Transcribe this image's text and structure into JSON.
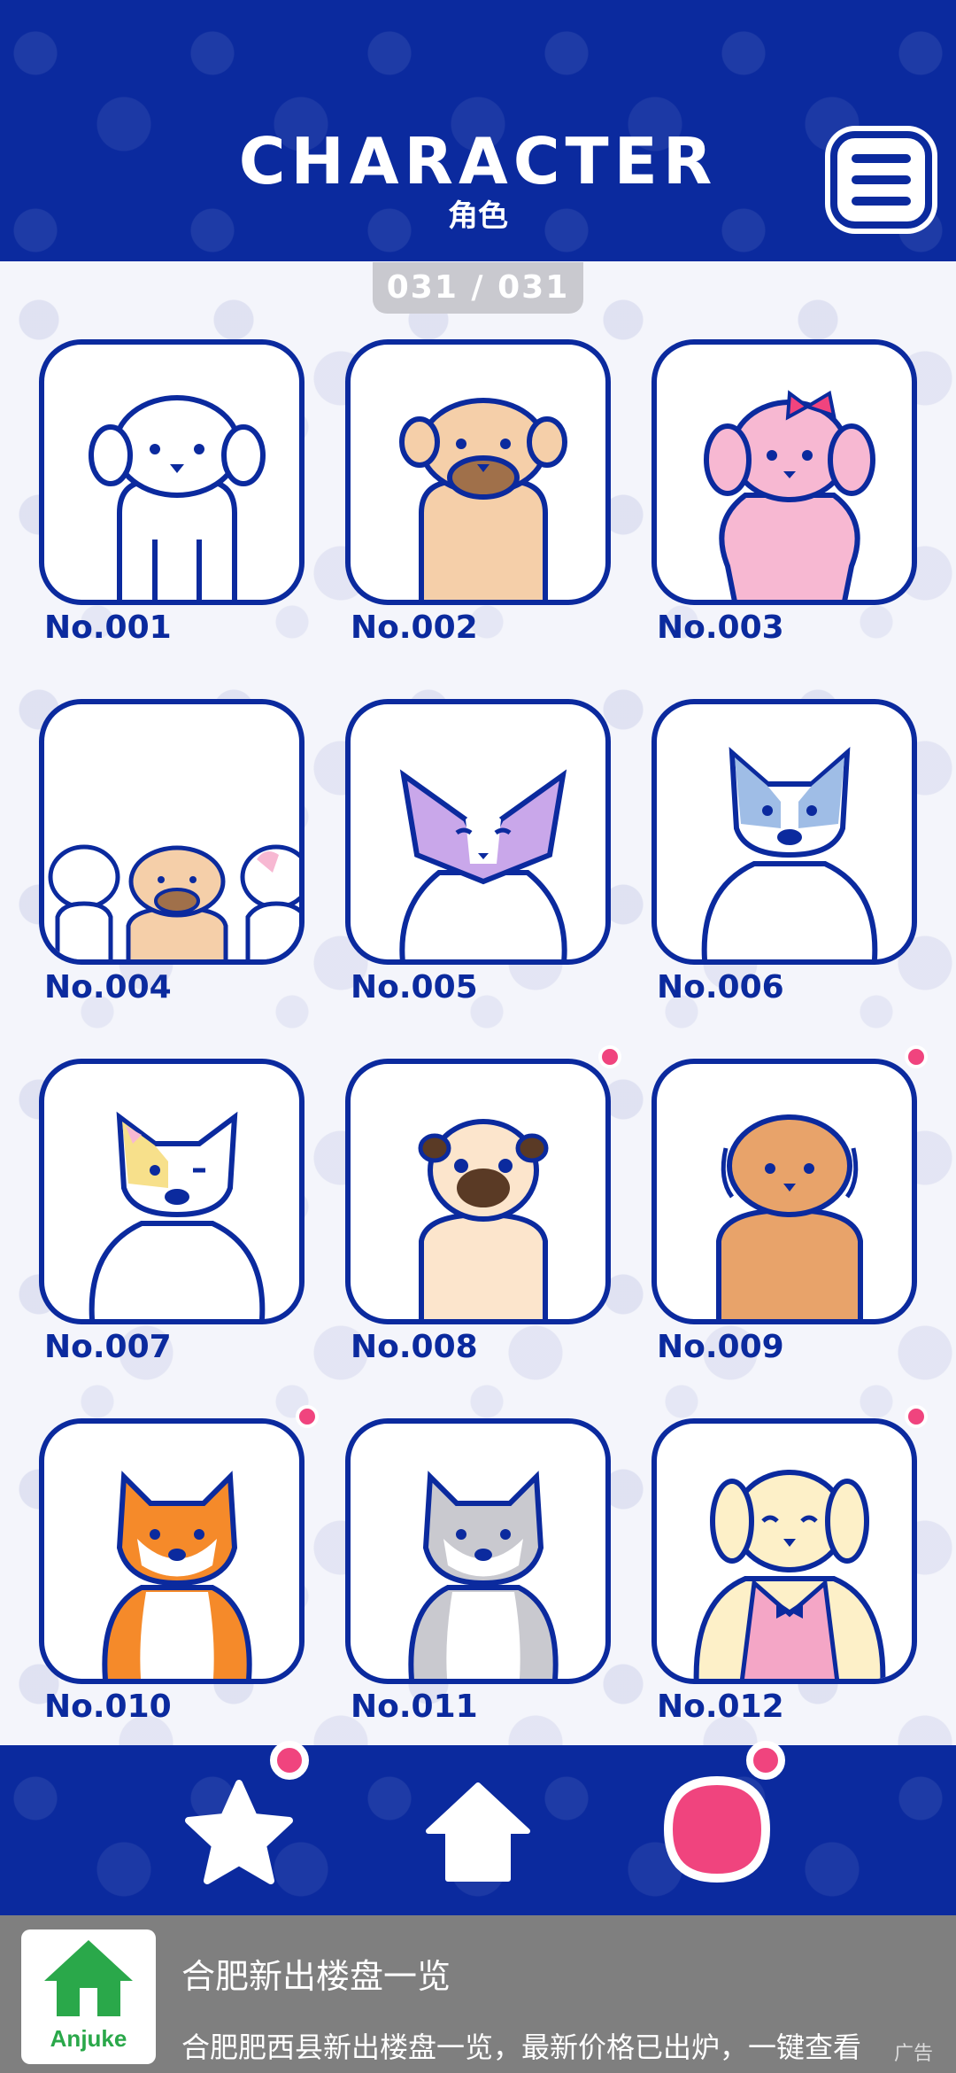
{
  "header": {
    "title": "CHARACTER",
    "subtitle": "角色"
  },
  "counter": "031 / 031",
  "characters": [
    {
      "label": "No.001",
      "new": false
    },
    {
      "label": "No.002",
      "new": false
    },
    {
      "label": "No.003",
      "new": false
    },
    {
      "label": "No.004",
      "new": false
    },
    {
      "label": "No.005",
      "new": false
    },
    {
      "label": "No.006",
      "new": false
    },
    {
      "label": "No.007",
      "new": false
    },
    {
      "label": "No.008",
      "new": true
    },
    {
      "label": "No.009",
      "new": true
    },
    {
      "label": "No.010",
      "new": true
    },
    {
      "label": "No.011",
      "new": false
    },
    {
      "label": "No.012",
      "new": true
    }
  ],
  "nav": {
    "items": [
      {
        "name": "favorites",
        "icon": "star-icon",
        "badge": true
      },
      {
        "name": "home",
        "icon": "house-icon",
        "badge": false
      },
      {
        "name": "character",
        "icon": "blob-icon",
        "badge": true
      }
    ]
  },
  "ad": {
    "brand": "Anjuke",
    "title": "合肥新出楼盘一览",
    "description": "合肥肥西县新出楼盘一览，最新价格已出炉，一键查看",
    "tag": "广告"
  },
  "colors": {
    "navy": "#0b2a9e",
    "pink": "#f0447e",
    "ad_bg": "#7f7f7f"
  }
}
